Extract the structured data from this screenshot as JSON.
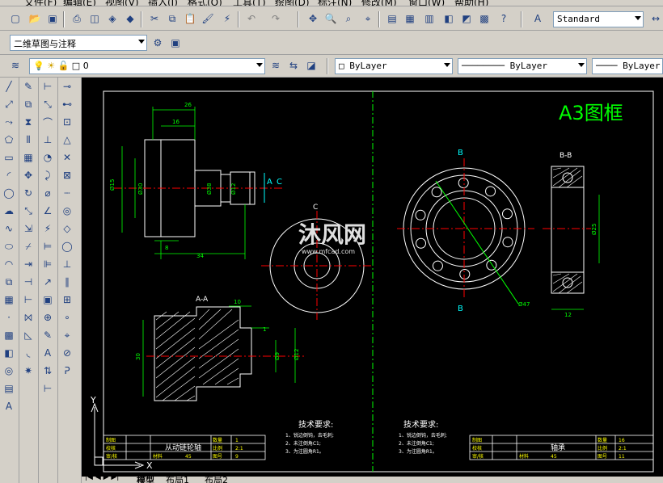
{
  "menu": {
    "items": [
      "文件(F)",
      "编辑(E)",
      "视图(V)",
      "插入(I)",
      "格式(O)",
      "工具(T)",
      "绘图(D)",
      "标注(N)",
      "修改(M)",
      "窗口(W)",
      "帮助(H)"
    ]
  },
  "toolbar": {
    "text_style": "Standard",
    "workspace": "二维草图与注释",
    "layer": "0",
    "color": "ByLayer",
    "linetype": "ByLayer",
    "lineweight": "ByLayer"
  },
  "drawing": {
    "frame_title": "A3图框",
    "watermark": "沐风网",
    "watermark_url": "www.mfcad.com",
    "section_aa": "A-A",
    "section_bb": "B-B",
    "label_c": "C",
    "label_a": "A",
    "label_c2": "C",
    "label_b": "B",
    "tech_req_title": "技术要求:",
    "tech_req_lines": [
      "1、锐边倒钝，去毛刺;",
      "2、未注倒角C1;",
      "3、为注圆角R1。"
    ],
    "dims": {
      "d26": "26",
      "d16": "16",
      "d15": "Ø15",
      "d30": "Ø30",
      "d38": "Ø38",
      "d12": "Ø12",
      "d8": "8",
      "d34": "34",
      "d10": "10",
      "d1": "1",
      "d30b": "30",
      "d9": "Ø9",
      "d12b": "Ø12",
      "d47": "Ø47",
      "d25": "Ø25",
      "d12c": "12"
    },
    "title_block_left": {
      "r1c1": "制图",
      "r2c1": "校核",
      "r3c1": "审/核",
      "name": "从动链轮轴",
      "count_label": "数量",
      "count": "1",
      "scale_label": "比例",
      "scale": "2:1",
      "sheet_label": "图号",
      "sheet": "9",
      "material_label": "材料",
      "material": "45"
    },
    "title_block_right": {
      "r1c1": "制图",
      "r2c1": "校核",
      "r3c1": "审/核",
      "name": "轴承",
      "count_label": "数量",
      "count": "16",
      "scale_label": "比例",
      "scale": "2:1",
      "sheet_label": "图号",
      "sheet": "11",
      "material_label": "材料",
      "material": "45"
    },
    "ucs_x": "X",
    "ucs_y": "Y"
  },
  "tabs": [
    "模型",
    "布局1",
    "布局2"
  ],
  "colors": {
    "canvas": "#000000",
    "frame": "#ffffff",
    "green": "#00ff00",
    "red": "#ff0000",
    "cyan": "#00ffff",
    "yellow": "#ffff00"
  }
}
